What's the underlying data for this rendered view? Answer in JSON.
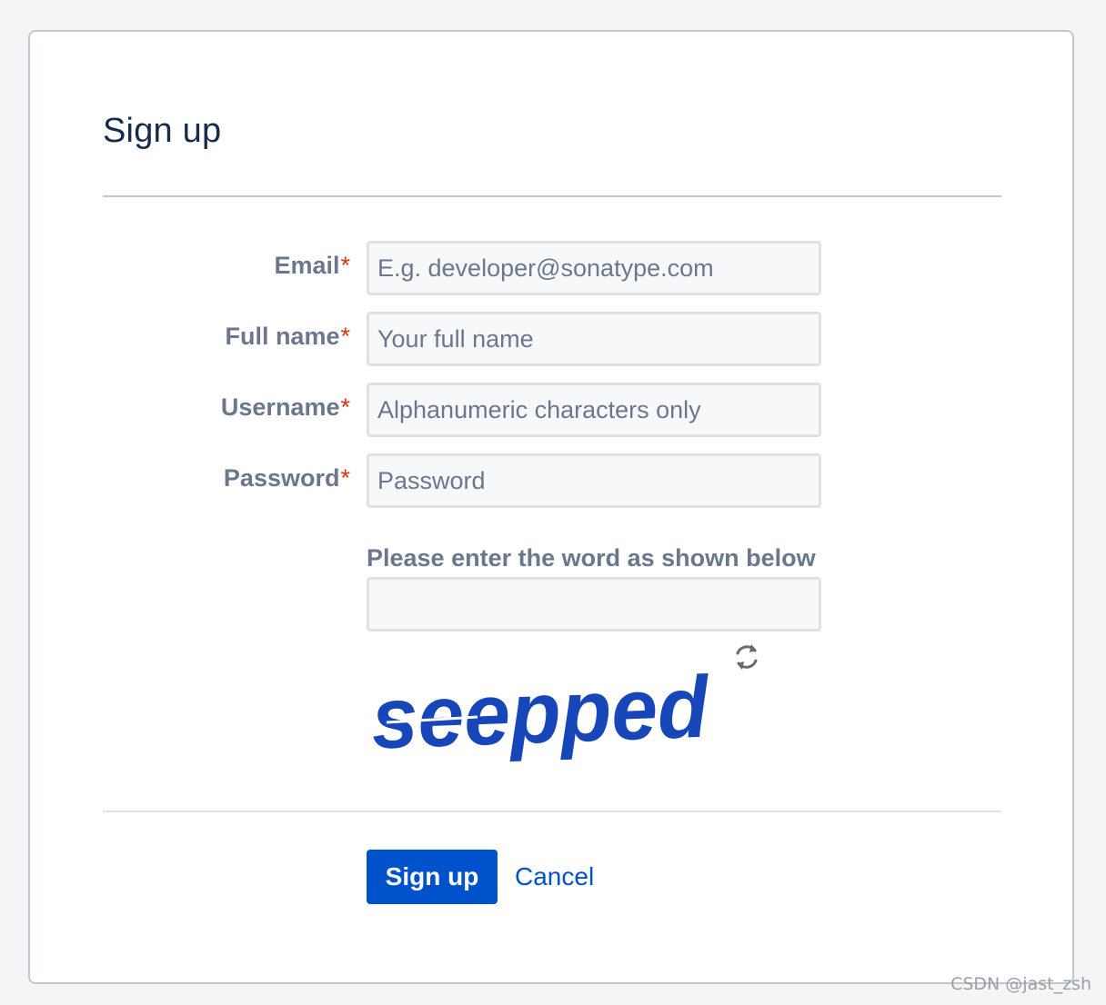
{
  "form": {
    "title": "Sign up",
    "required_marker": "*",
    "fields": [
      {
        "label": "Email",
        "value": "",
        "placeholder": "E.g. developer@sonatype.com"
      },
      {
        "label": "Full name",
        "value": "",
        "placeholder": "Your full name"
      },
      {
        "label": "Username",
        "value": "",
        "placeholder": "Alphanumeric characters only"
      },
      {
        "label": "Password",
        "value": "",
        "placeholder": "Password"
      }
    ],
    "captcha": {
      "label": "Please enter the word as shown below",
      "value": "",
      "word": "seepped",
      "refresh_icon": "refresh-icon"
    },
    "actions": {
      "submit_label": "Sign up",
      "cancel_label": "Cancel"
    }
  },
  "watermark": "CSDN @jast_zsh",
  "colors": {
    "primary": "#0052cc",
    "required": "#de350b",
    "captcha_text": "#1746b8"
  }
}
